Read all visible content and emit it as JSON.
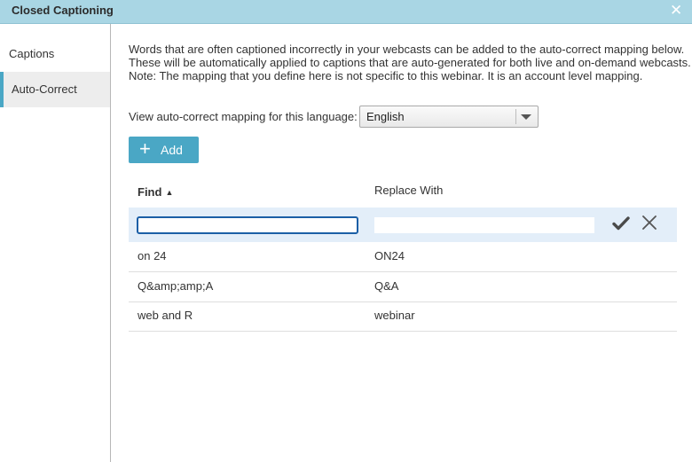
{
  "dialog": {
    "title": "Closed Captioning",
    "close_icon": "close-icon"
  },
  "sidebar": {
    "items": [
      {
        "label": "Captions",
        "active": false
      },
      {
        "label": "Auto-Correct",
        "active": true
      }
    ]
  },
  "main": {
    "description": [
      "Words that are often captioned incorrectly in your webcasts can be added to the auto-correct mapping below.",
      "These will be automatically applied to captions that are auto-generated for both live and on-demand webcasts.",
      "Note: The mapping that you define here is not specific to this webinar. It is an account level mapping."
    ],
    "language_label": "View auto-correct mapping for this language:",
    "language_value": "English",
    "add_label": "Add",
    "table": {
      "headers": {
        "find": "Find",
        "replace": "Replace With"
      },
      "new_row": {
        "find_value": "",
        "replace_value": ""
      },
      "rows": [
        {
          "find": "on 24",
          "replace": "ON24"
        },
        {
          "find": "Q&amp;amp;A",
          "replace": "Q&A"
        },
        {
          "find": "web and R",
          "replace": "webinar"
        }
      ]
    }
  },
  "colors": {
    "titlebar": "#a9d6e4",
    "accent": "#4aa7c5",
    "edit_row": "#e3eef9",
    "focus": "#1b5fa6"
  }
}
